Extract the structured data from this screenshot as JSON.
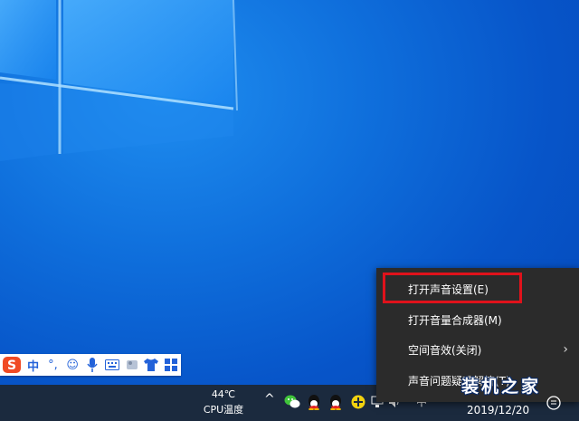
{
  "desktop": {
    "ime_toolbar": {
      "logo": "S",
      "mode": "中",
      "punct": "°,",
      "emoji": "☺",
      "mic": "mic-icon",
      "keyboard": "keyboard-icon",
      "skin": "shirt-icon",
      "more": "grid-icon"
    },
    "taskbar": {
      "cpu_temp": "44℃",
      "cpu_label": "CPU温度",
      "chevron": "^",
      "ime_char": "中",
      "clock_date": "2019/12/20",
      "tray_icons": [
        "wechat-icon",
        "qq-icon",
        "qq-icon",
        "plus-icon",
        "network-icon",
        "volume-icon"
      ]
    },
    "context_menu": {
      "items": [
        {
          "label": "打开声音设置(E)"
        },
        {
          "label": "打开音量合成器(M)"
        },
        {
          "label": "空间音效(关闭)",
          "has_submenu": true
        },
        {
          "label": "声音问题疑难解答(T)"
        }
      ]
    },
    "watermark": "装机之家",
    "colors": {
      "menu_bg": "#2b2b2b",
      "highlight": "#e0121b",
      "taskbar": "#1b2a3e",
      "ime_blue": "#2362d9",
      "sogou_red": "#f04a24"
    }
  }
}
